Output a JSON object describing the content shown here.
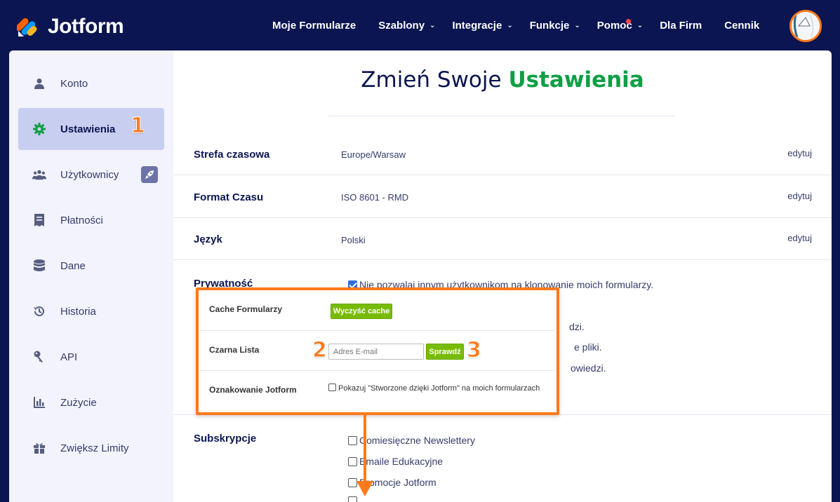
{
  "brand": {
    "name": "Jotform"
  },
  "nav": {
    "items": [
      {
        "label": "Moje Formularze",
        "has_chevron": false
      },
      {
        "label": "Szablony",
        "has_chevron": true
      },
      {
        "label": "Integracje",
        "has_chevron": true
      },
      {
        "label": "Funkcje",
        "has_chevron": true
      },
      {
        "label": "Pomoc",
        "has_chevron": true,
        "notification_dot": true
      },
      {
        "label": "Dla Firm",
        "has_chevron": false
      },
      {
        "label": "Cennik",
        "has_chevron": false
      }
    ],
    "chevron": "⌄"
  },
  "sidebar": {
    "items": [
      {
        "label": "Konto",
        "icon": "user-icon"
      },
      {
        "label": "Ustawienia",
        "icon": "gear-icon",
        "active": true
      },
      {
        "label": "Użytkownicy",
        "icon": "users-icon",
        "badge_icon": "rocket-icon"
      },
      {
        "label": "Płatności",
        "icon": "receipt-icon"
      },
      {
        "label": "Dane",
        "icon": "database-icon"
      },
      {
        "label": "Historia",
        "icon": "history-icon"
      },
      {
        "label": "API",
        "icon": "key-icon"
      },
      {
        "label": "Zużycie",
        "icon": "bar-chart-icon"
      },
      {
        "label": "Zwiększ Limity",
        "icon": "gift-icon"
      }
    ]
  },
  "page": {
    "title_plain": "Zmień Swoje",
    "title_accent": "Ustawienia"
  },
  "settings": {
    "rows": [
      {
        "label": "Strefa czasowa",
        "value": "Europe/Warsaw",
        "edit": "edytuj"
      },
      {
        "label": "Format Czasu",
        "value": "ISO 8601 - RMD",
        "edit": "edytuj"
      },
      {
        "label": "Język",
        "value": "Polski",
        "edit": "edytuj"
      }
    ],
    "privacy": {
      "label": "Prywatność",
      "options": [
        {
          "text": "Nie pozwalaj innym użytkownikom na klonowanie moich formularzy.",
          "checked": true
        },
        {
          "text": "dzi.",
          "checked": false
        },
        {
          "text": "e pliki.",
          "checked": false
        },
        {
          "text": "owiedzi.",
          "checked": false
        }
      ]
    },
    "subscriptions": {
      "label": "Subskrypcje",
      "options": [
        {
          "text": "Comiesięczne Newslettery",
          "checked": false
        },
        {
          "text": "Emaile Edukacyjne",
          "checked": false
        },
        {
          "text": "Promocje Jotform",
          "checked": false
        }
      ]
    }
  },
  "overlay": {
    "cache": {
      "label": "Cache Formularzy",
      "button": "Wyczyść cache"
    },
    "blacklist": {
      "label": "Czarna Lista",
      "placeholder": "Adres E-mail",
      "button": "Sprawdź"
    },
    "branding": {
      "label": "Oznakowanie Jotform",
      "checkbox_text": "Pokazuj \"Stworzone dzięki Jotform\" na moich formularzach",
      "checked": false
    }
  },
  "annotations": {
    "step1": "1",
    "step2": "2",
    "step3": "3"
  },
  "colors": {
    "nav_bg": "#0a1551",
    "accent_green": "#0f9f45",
    "annotation_orange": "#ff7a1a",
    "button_green": "#78bb07"
  }
}
